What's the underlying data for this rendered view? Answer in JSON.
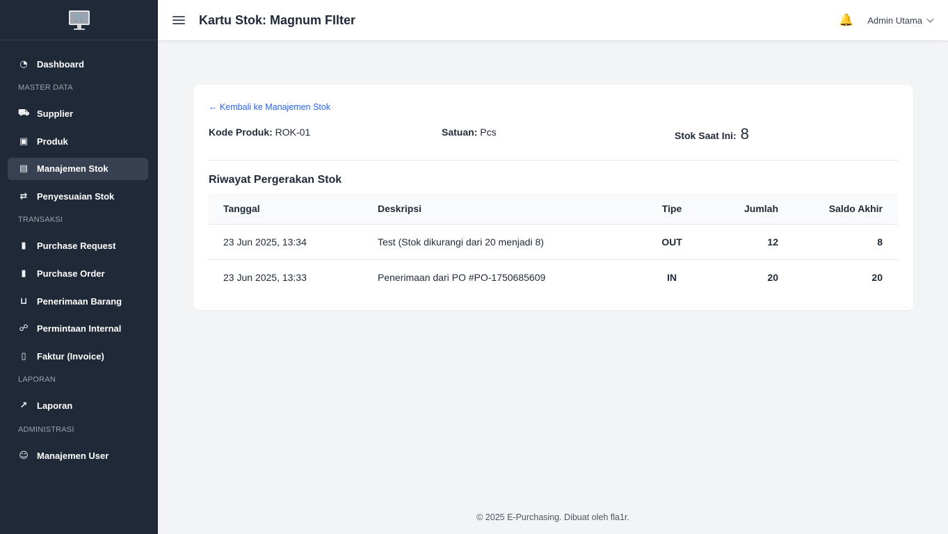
{
  "app": {
    "logo_icon": "computer-cart-icon"
  },
  "sidebar": {
    "items": [
      {
        "type": "item",
        "label": "Dashboard",
        "icon": "◔",
        "icon_name": "dashboard-gauge-icon",
        "name": "sidebar-item-dashboard",
        "active": false
      },
      {
        "type": "section",
        "label": "MASTER DATA"
      },
      {
        "type": "item",
        "label": "Supplier",
        "icon": "⛟",
        "icon_name": "truck-icon",
        "name": "sidebar-item-supplier",
        "active": false
      },
      {
        "type": "item",
        "label": "Produk",
        "icon": "▣",
        "icon_name": "box-icon",
        "name": "sidebar-item-produk",
        "active": false
      },
      {
        "type": "item",
        "label": "Manajemen Stok",
        "icon": "▤",
        "icon_name": "warehouse-icon",
        "name": "sidebar-item-manajemen-stok",
        "active": true
      },
      {
        "type": "item",
        "label": "Penyesuaian Stok",
        "icon": "⇄",
        "icon_name": "exchange-icon",
        "name": "sidebar-item-penyesuaian-stok",
        "active": false
      },
      {
        "type": "section",
        "label": "TRANSAKSI"
      },
      {
        "type": "item",
        "label": "Purchase Request",
        "icon": "▮",
        "icon_name": "file-icon",
        "name": "sidebar-item-purchase-request",
        "active": false
      },
      {
        "type": "item",
        "label": "Purchase Order",
        "icon": "▮",
        "icon_name": "file-invoice-icon",
        "name": "sidebar-item-purchase-order",
        "active": false
      },
      {
        "type": "item",
        "label": "Penerimaan Barang",
        "icon": "⊔",
        "icon_name": "dolly-icon",
        "name": "sidebar-item-penerimaan-barang",
        "active": false
      },
      {
        "type": "item",
        "label": "Permintaan Internal",
        "icon": "☍",
        "icon_name": "people-carry-icon",
        "name": "sidebar-item-permintaan-internal",
        "active": false
      },
      {
        "type": "item",
        "label": "Faktur (Invoice)",
        "icon": "▯",
        "icon_name": "receipt-icon",
        "name": "sidebar-item-faktur",
        "active": false
      },
      {
        "type": "section",
        "label": "LAPORAN"
      },
      {
        "type": "item",
        "label": "Laporan",
        "icon": "↗",
        "icon_name": "chart-line-icon",
        "name": "sidebar-item-laporan",
        "active": false
      },
      {
        "type": "section",
        "label": "ADMINISTRASI"
      },
      {
        "type": "item",
        "label": "Manajemen User",
        "icon": "☺",
        "icon_name": "users-cog-icon",
        "name": "sidebar-item-manajemen-user",
        "active": false
      }
    ]
  },
  "header": {
    "title": "Kartu Stok: Magnum FIlter",
    "menu_icon": "hamburger-icon",
    "bell_icon": "bell-icon",
    "user_name": "Admin Utama"
  },
  "card": {
    "back_link": "← Kembali ke Manajemen Stok",
    "kode_label": "Kode Produk:",
    "kode_value": "ROK-01",
    "satuan_label": "Satuan:",
    "satuan_value": "Pcs",
    "stok_label": "Stok Saat Ini:",
    "stok_value": "8",
    "section_title": "Riwayat Pergerakan Stok"
  },
  "table": {
    "headers": [
      "Tanggal",
      "Deskripsi",
      "Tipe",
      "Jumlah",
      "Saldo Akhir"
    ],
    "rows": [
      {
        "tanggal": "23 Jun 2025, 13:34",
        "deskripsi": "Test (Stok dikurangi dari 20 menjadi 8)",
        "tipe": "OUT",
        "jumlah": "12",
        "saldo": "8"
      },
      {
        "tanggal": "23 Jun 2025, 13:33",
        "deskripsi": "Penerimaan dari PO #PO-1750685609",
        "tipe": "IN",
        "jumlah": "20",
        "saldo": "20"
      }
    ]
  },
  "colors": {
    "sidebar_bg": "#1f2937",
    "link": "#2563eb",
    "out": "#dc2626",
    "in": "#16a34a"
  },
  "footer": {
    "text": "© 2025 E-Purchasing. Dibuat oleh fla1r."
  }
}
